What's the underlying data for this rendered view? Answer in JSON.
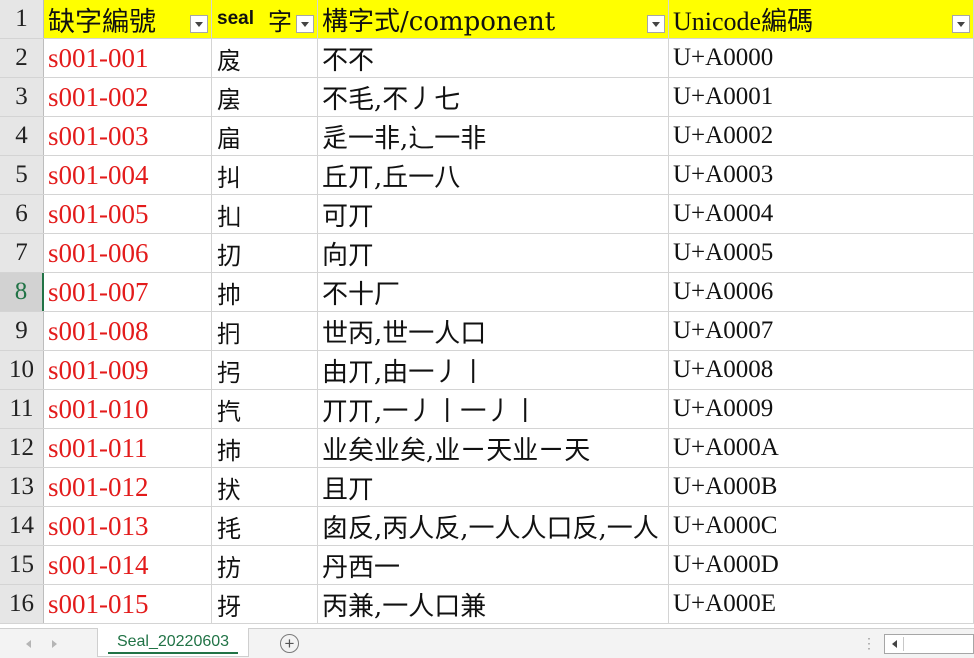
{
  "header": {
    "row_number": "1",
    "col_a": "缺字編號",
    "col_b_seal": "seal",
    "col_b_zi": "字",
    "col_c": "構字式/component",
    "col_d": "Unicode編碼"
  },
  "active_row": "8",
  "rows": [
    {
      "num": "2",
      "id": "s001-001",
      "char": "㧀",
      "component": "不不",
      "unicode": "U+A0000"
    },
    {
      "num": "3",
      "id": "s001-002",
      "char": "㧁",
      "component": "不毛,不丿七",
      "unicode": "U+A0001"
    },
    {
      "num": "4",
      "id": "s001-003",
      "char": "㧂",
      "component": "辵一非,辶一非",
      "unicode": "U+A0002"
    },
    {
      "num": "5",
      "id": "s001-004",
      "char": "㧃",
      "component": "丘丌,丘一八",
      "unicode": "U+A0003"
    },
    {
      "num": "6",
      "id": "s001-005",
      "char": "㧄",
      "component": "可丌",
      "unicode": "U+A0004"
    },
    {
      "num": "7",
      "id": "s001-006",
      "char": "㧅",
      "component": "向丌",
      "unicode": "U+A0005"
    },
    {
      "num": "8",
      "id": "s001-007",
      "char": "㧆",
      "component": "不十厂",
      "unicode": "U+A0006"
    },
    {
      "num": "9",
      "id": "s001-008",
      "char": "㧇",
      "component": "世丙,世一人口",
      "unicode": "U+A0007"
    },
    {
      "num": "10",
      "id": "s001-009",
      "char": "㧈",
      "component": "由丌,由一丿丨",
      "unicode": "U+A0008"
    },
    {
      "num": "11",
      "id": "s001-010",
      "char": "㧉",
      "component": "丌丌,一丿丨一丿丨",
      "unicode": "U+A0009"
    },
    {
      "num": "12",
      "id": "s001-011",
      "char": "㧊",
      "component": "业矣业矣,业ㄧ天业ㄧ天",
      "unicode": "U+A000A"
    },
    {
      "num": "13",
      "id": "s001-012",
      "char": "㧋",
      "component": "且丌",
      "unicode": "U+A000B"
    },
    {
      "num": "14",
      "id": "s001-013",
      "char": "㧌",
      "component": "囱反,丙人反,一人人口反,一人",
      "unicode": "U+A000C"
    },
    {
      "num": "15",
      "id": "s001-014",
      "char": "㧍",
      "component": "丹西一",
      "unicode": "U+A000D"
    },
    {
      "num": "16",
      "id": "s001-015",
      "char": "㧎",
      "component": "丙兼,一人口兼",
      "unicode": "U+A000E"
    }
  ],
  "bottom": {
    "sheet_tab": "Seal_20220603",
    "add_sheet": "+",
    "overflow": "⋮"
  },
  "colors": {
    "header_fill": "#ffff00",
    "id_text": "#e31b1b",
    "active_accent": "#217346"
  }
}
